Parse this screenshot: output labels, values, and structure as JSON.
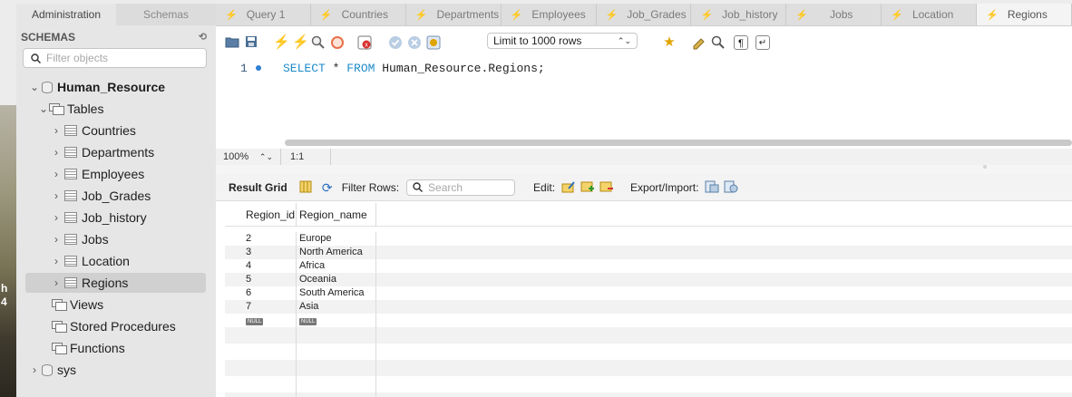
{
  "sidebar": {
    "tabs": [
      "Administration",
      "Schemas"
    ],
    "header": "SCHEMAS",
    "filter_placeholder": "Filter objects",
    "schema": "Human_Resource",
    "tables_label": "Tables",
    "tables": [
      "Countries",
      "Departments",
      "Employees",
      "Job_Grades",
      "Job_history",
      "Jobs",
      "Location",
      "Regions"
    ],
    "selected_table": "Regions",
    "other_nodes": [
      "Views",
      "Stored Procedures",
      "Functions"
    ],
    "other_schema": "sys"
  },
  "query_tabs": [
    "Query 1",
    "Countries",
    "Departments",
    "Employees",
    "Job_Grades",
    "Job_history",
    "Jobs",
    "Location",
    "Regions"
  ],
  "active_query_tab": "Regions",
  "toolbar": {
    "limit": "Limit to 1000 rows"
  },
  "editor": {
    "line_number": "1",
    "keyword_select": "SELECT",
    "star": " * ",
    "keyword_from": "FROM",
    "rest": " Human_Resource.Regions;"
  },
  "status": {
    "zoom": "100%",
    "position": "1:1"
  },
  "result": {
    "title": "Result Grid",
    "filter_label": "Filter Rows:",
    "search_placeholder": "Search",
    "edit_label": "Edit:",
    "export_label": "Export/Import:",
    "columns": [
      "Region_id",
      "Region_name"
    ],
    "rows": [
      [
        "2",
        "Europe"
      ],
      [
        "3",
        "North America"
      ],
      [
        "4",
        "Africa"
      ],
      [
        "5",
        "Oceania"
      ],
      [
        "6",
        "South America"
      ],
      [
        "7",
        "Asia"
      ]
    ],
    "null_text": "NULL"
  },
  "desktop_text": [
    "h",
    "4"
  ]
}
